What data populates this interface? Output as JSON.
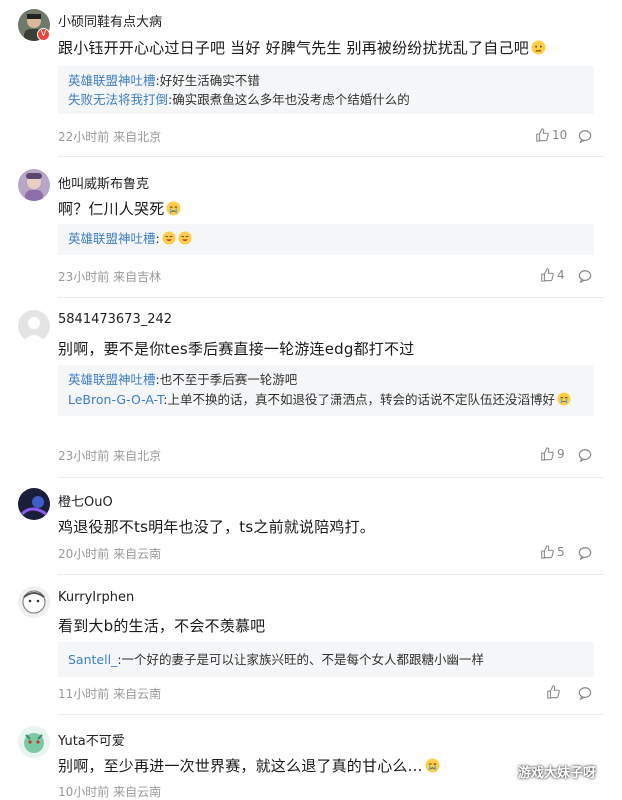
{
  "colors": {
    "reply_name": "#3f7fc4",
    "meta_text": "#999999",
    "reply_bg": "#f5f6f7",
    "badge": "#e8453c"
  },
  "comments": [
    {
      "username": "小硕同鞋有点大病",
      "text": "跟小钰开开心心过日子吧 当好 好脾气先生 别再被纷纷扰扰乱了自己吧",
      "text_emoji": "emoji-face-icon",
      "badge": "V",
      "replies": [
        {
          "name": "英雄联盟神吐槽",
          "text": ":好好生活确实不错"
        },
        {
          "name": "失败无法将我打倒",
          "text": ":确实跟煮鱼这么多年也没考虑个结婚什么的"
        }
      ],
      "time": "22小时前 来自北京",
      "likes": "10"
    },
    {
      "username": "他叫威斯布鲁克",
      "text": "啊？仁川人哭死",
      "text_emoji": "crying-emoji-icon",
      "replies": [
        {
          "name": "英雄联盟神吐槽",
          "text": ":"
        }
      ],
      "time": "23小时前 来自吉林",
      "likes": "4"
    },
    {
      "username": "5841473673_242",
      "text": "别啊，要不是你tes季后赛直接一轮游连edg都打不过",
      "replies": [
        {
          "name": "英雄联盟神吐槽",
          "text": ":也不至于季后赛一轮游吧"
        },
        {
          "name": "LeBron-G-O-A-T",
          "text": ":上单不换的话，真不如退役了潇洒点，转会的话说不定队伍还没滔博好"
        }
      ],
      "time": "23小时前 来自北京",
      "likes": "9"
    },
    {
      "username": "橙七OuO",
      "text": "鸡退役那不ts明年也没了，ts之前就说陪鸡打。",
      "replies": [],
      "time": "20小时前 来自云南",
      "likes": "5"
    },
    {
      "username": "KurryIrphen",
      "text": "看到大b的生活，不会不羡慕吧",
      "replies": [
        {
          "name": "Santell_",
          "text": ":一个好的妻子是可以让家族兴旺的、不是每个女人都跟糖小幽一样"
        }
      ],
      "time": "11小时前 来自云南",
      "likes": ""
    },
    {
      "username": "Yuta不可爱",
      "text": "别啊，至少再进一次世界赛，就这么退了真的甘心么...",
      "text_emoji": "crying-emoji-icon",
      "replies": [],
      "time": "10小时前 来自云南",
      "likes": ""
    }
  ],
  "watermark": "游戏大妹子呀"
}
